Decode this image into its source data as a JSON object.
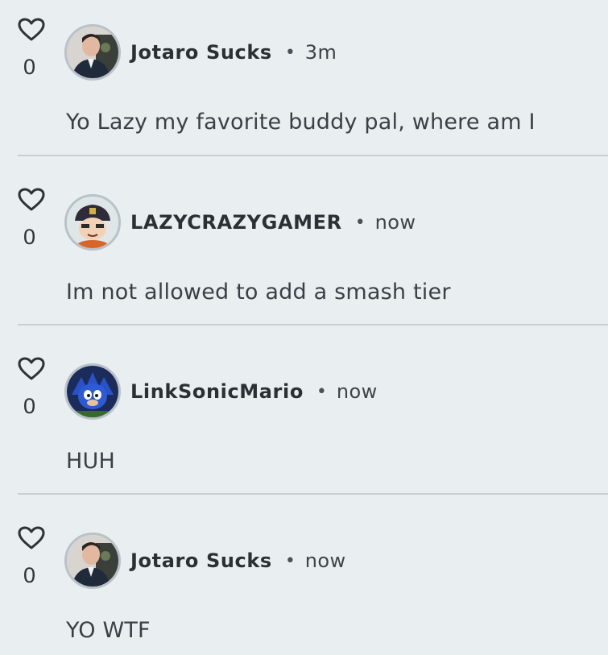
{
  "comments": [
    {
      "likes": "0",
      "username": "Jotaro Sucks",
      "separator": "•",
      "time": "3m",
      "text": "Yo Lazy my favorite buddy pal, where am I",
      "avatar_icon": "man-in-suit-avatar-icon"
    },
    {
      "likes": "0",
      "username": "LAZYCRAZYGAMER",
      "separator": "•",
      "time": "now",
      "text": "Im not allowed to add a smash tier",
      "avatar_icon": "cartoon-character-avatar-icon"
    },
    {
      "likes": "0",
      "username": "LinkSonicMario",
      "separator": "•",
      "time": "now",
      "text": "HUH",
      "avatar_icon": "blue-hedgehog-avatar-icon"
    },
    {
      "likes": "0",
      "username": "Jotaro Sucks",
      "separator": "•",
      "time": "now",
      "text": "YO WTF",
      "avatar_icon": "man-in-suit-avatar-icon"
    }
  ],
  "icons": {
    "like": "heart-icon"
  },
  "colors": {
    "background": "#e9eef1",
    "divider": "#c8cfd4",
    "text": "#2b3034"
  }
}
